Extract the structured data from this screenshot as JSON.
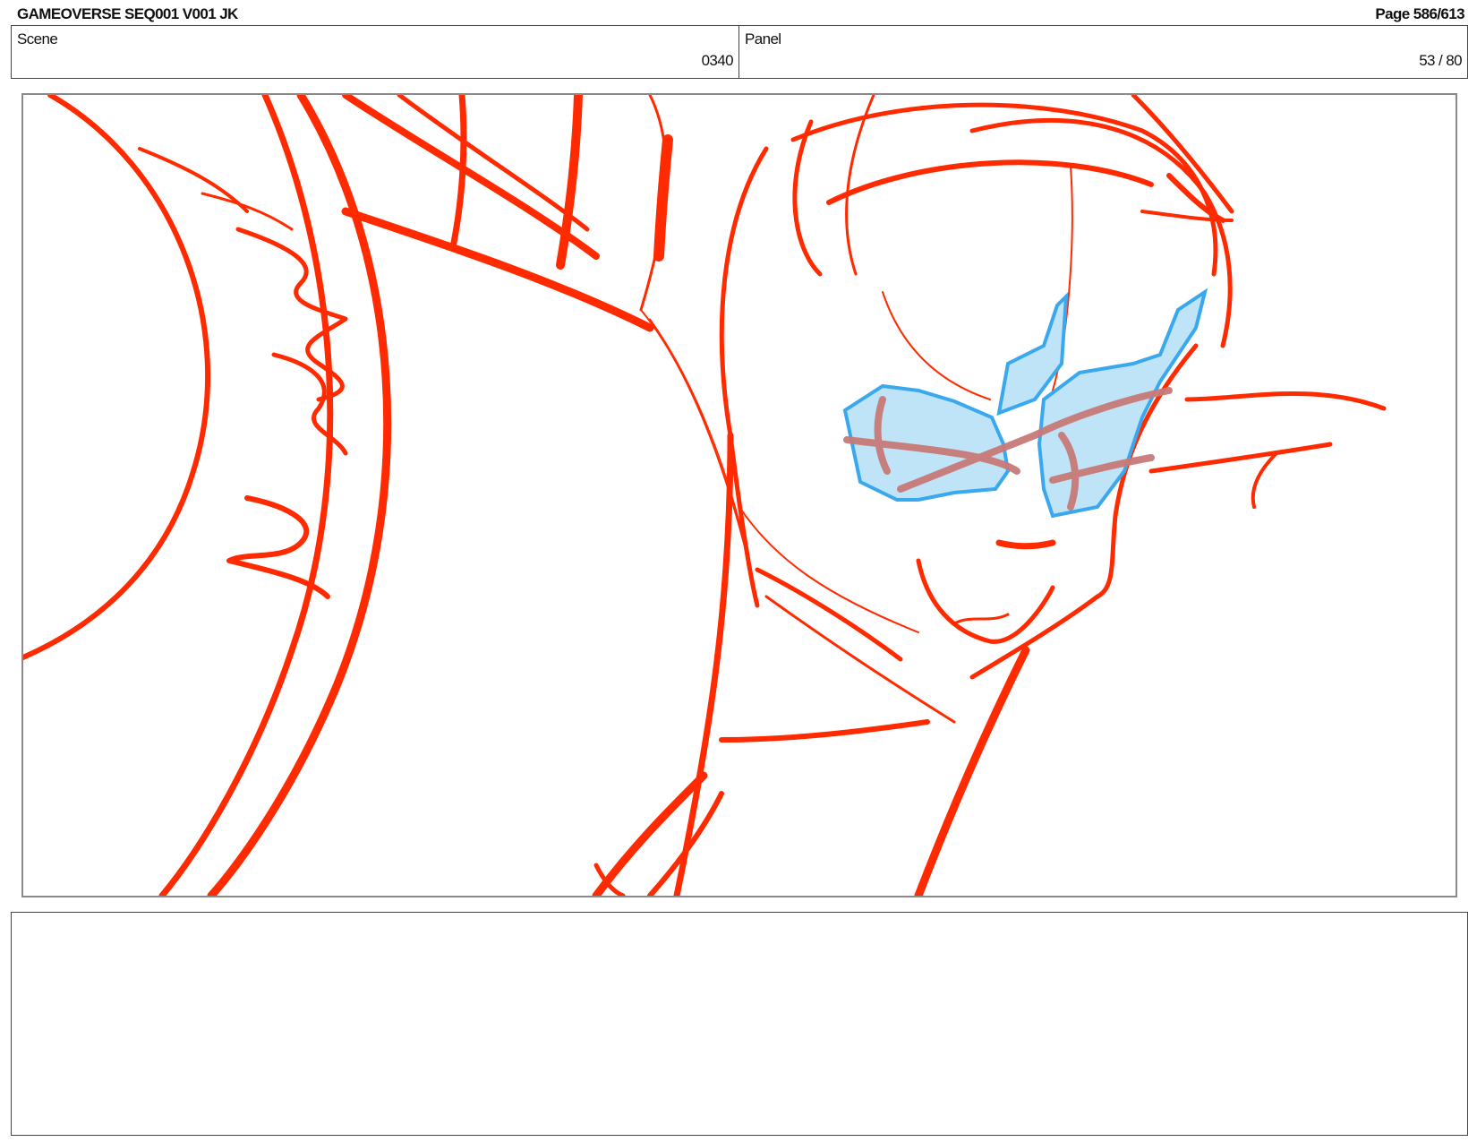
{
  "header": {
    "title": "GAMEOVERSE SEQ001 V001 JK",
    "page": "Page 586/613"
  },
  "info": {
    "scene_label": "Scene",
    "scene_value": "0340",
    "panel_label": "Panel",
    "panel_value": "53 / 80"
  },
  "notes": {
    "text": ""
  },
  "colors": {
    "sketch_line": "#ff2a00",
    "lens_fill": "#bfe3f7",
    "lens_outline": "#3aa8ee",
    "lens_marks": "#c87a78"
  }
}
